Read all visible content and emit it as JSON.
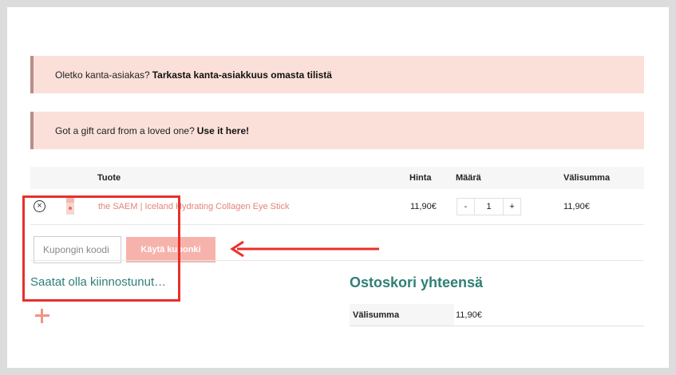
{
  "notices": {
    "customer_prefix": "Oletko kanta-asiakas?",
    "customer_link": "Tarkasta kanta-asiakkuus omasta tilistä",
    "gift_prefix": "Got a gift card from a loved one?",
    "gift_link": "Use it here!"
  },
  "cart": {
    "headers": {
      "product": "Tuote",
      "price": "Hinta",
      "quantity": "Määrä",
      "subtotal": "Välisumma"
    },
    "items": [
      {
        "remove_icon": "×",
        "name": "the SAEM | Iceland Hydrating Collagen Eye Stick",
        "price": "11,90€",
        "qty_minus": "-",
        "quantity": "1",
        "qty_plus": "+",
        "subtotal": "11,90€"
      }
    ]
  },
  "coupon": {
    "placeholder": "Kupongin koodi",
    "button_label": "Käytä kuponki"
  },
  "interest_heading": "Saatat olla kiinnostunut…",
  "totals": {
    "title": "Ostoskori yhteensä",
    "subtotal_label": "Välisumma",
    "subtotal_value": "11,90€"
  },
  "colors": {
    "accent": "#2f7f76",
    "notice_bg": "#fbe0da",
    "button_bg": "#f6b3ac",
    "annotation": "#e8302b"
  }
}
